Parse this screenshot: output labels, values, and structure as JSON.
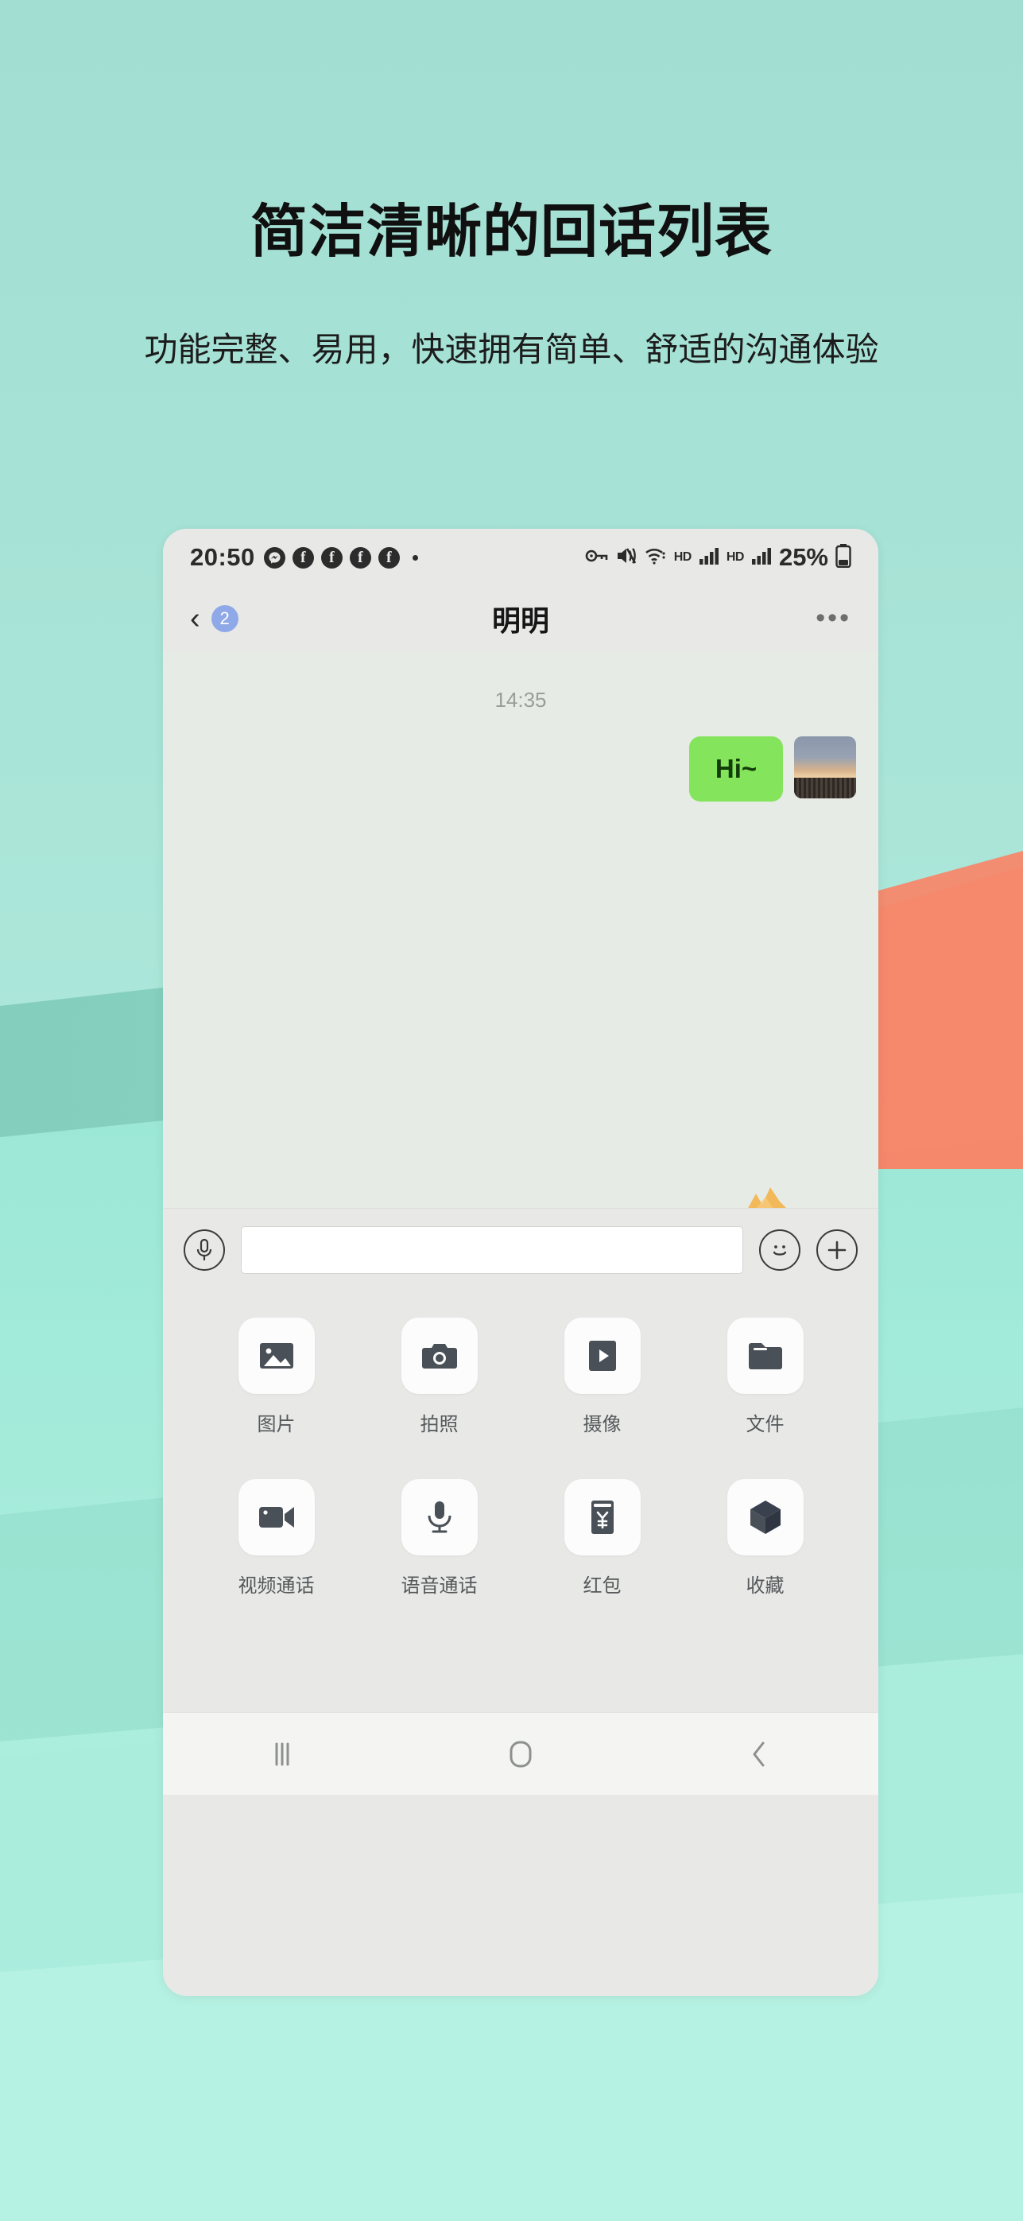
{
  "promo": {
    "headline": "简洁清晰的回话列表",
    "subhead": "功能完整、易用，快速拥有简单、舒适的沟通体验"
  },
  "colors": {
    "background_mint": "#9ddfd4",
    "background_mint_light": "#b6f0e3",
    "background_teal": "#7cc9b8",
    "background_orange": "#f5886b",
    "bubble_green": "#84e45b",
    "badge_blue": "#8fa8e8",
    "phone_surface": "#e8e9e7",
    "chat_surface": "#e7ebe6"
  },
  "phone": {
    "statusbar": {
      "time": "20:50",
      "battery": "25%",
      "left_icons": [
        "messenger-icon",
        "facebook-icon",
        "facebook-icon",
        "facebook-icon",
        "facebook-icon",
        "more-notifications-dot"
      ],
      "right_icons": [
        "vpn-key-icon",
        "volume-mute-icon",
        "wifi-icon",
        "hd-badge-icon",
        "signal-bars-icon",
        "hd-badge-icon",
        "signal-bars-icon",
        "battery-icon"
      ],
      "hd_label": "HD"
    },
    "header": {
      "back_icon": "back-chevron-icon",
      "back_glyph": "‹",
      "unread_count": "2",
      "title": "明明",
      "more_icon": "more-options-icon",
      "more_glyph": "•••"
    },
    "chat": {
      "time_divider": "14:35",
      "messages": [
        {
          "text": "Hi~",
          "side": "outgoing",
          "avatar": "user-avatar-photo"
        }
      ]
    },
    "input_bar": {
      "voice_icon": "microphone-icon",
      "emoji_icon": "emoji-smiley-icon",
      "add_icon": "plus-icon",
      "field_value": "",
      "field_placeholder": ""
    },
    "attachments": {
      "rows": [
        [
          {
            "label": "图片",
            "icon": "image-icon"
          },
          {
            "label": "拍照",
            "icon": "camera-icon"
          },
          {
            "label": "摄像",
            "icon": "video-record-icon"
          },
          {
            "label": "文件",
            "icon": "folder-icon"
          }
        ],
        [
          {
            "label": "视频通话",
            "icon": "video-call-icon"
          },
          {
            "label": "语音通话",
            "icon": "voice-call-microphone-icon"
          },
          {
            "label": "红包",
            "icon": "red-packet-icon"
          },
          {
            "label": "收藏",
            "icon": "favorites-cube-icon"
          }
        ]
      ]
    },
    "navbar": {
      "recents_icon": "recents-icon",
      "home_icon": "home-icon",
      "back_icon": "nav-back-icon"
    }
  }
}
